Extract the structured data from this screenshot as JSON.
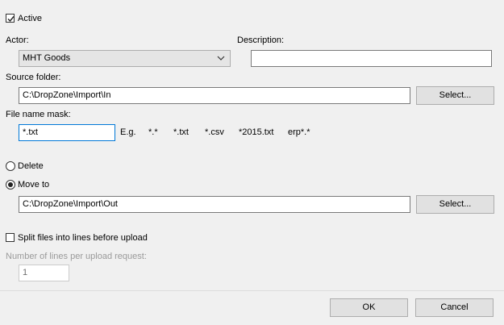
{
  "active": {
    "label": "Active",
    "checked": true
  },
  "actor": {
    "label": "Actor:",
    "value": "MHT Goods"
  },
  "description": {
    "label": "Description:",
    "value": ""
  },
  "source_folder": {
    "label": "Source folder:",
    "value": "C:\\DropZone\\Import\\In",
    "select_label": "Select..."
  },
  "file_mask": {
    "label": "File name mask:",
    "value": "*.txt",
    "eg_label": "E.g.",
    "examples": [
      "*.*",
      "*.txt",
      "*.csv",
      "*2015.txt",
      "erp*.*"
    ]
  },
  "after_upload": {
    "delete_label": "Delete",
    "move_label": "Move to",
    "selected": "move"
  },
  "move_folder": {
    "value": "C:\\DropZone\\Import\\Out",
    "select_label": "Select..."
  },
  "split": {
    "label": "Split files into lines before upload",
    "checked": false,
    "lines_label": "Number of lines per upload request:",
    "lines_value": "1"
  },
  "footer": {
    "ok_label": "OK",
    "cancel_label": "Cancel"
  }
}
